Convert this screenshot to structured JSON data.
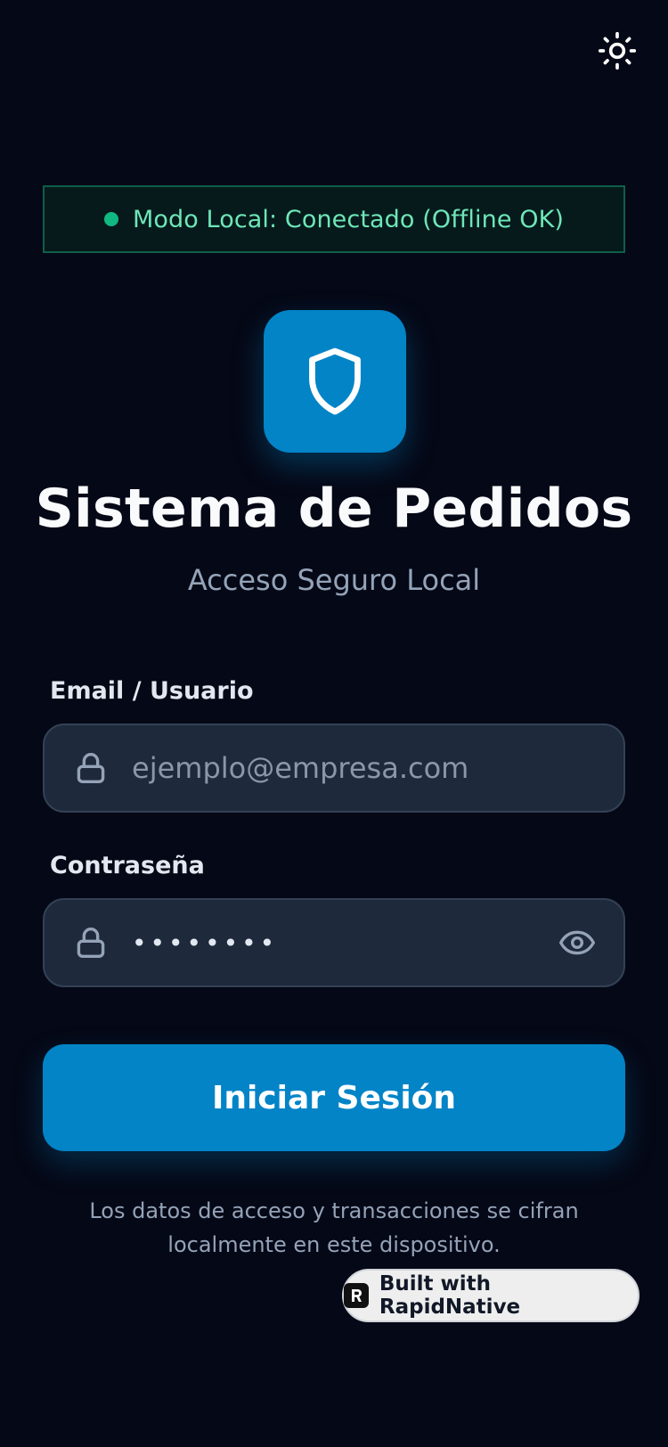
{
  "status": {
    "text": "Modo Local: Conectado (Offline OK)"
  },
  "header": {
    "title": "Sistema de Pedidos",
    "subtitle": "Acceso Seguro Local"
  },
  "form": {
    "email": {
      "label": "Email / Usuario",
      "placeholder": "ejemplo@empresa.com",
      "value": ""
    },
    "password": {
      "label": "Contraseña",
      "value": "••••••••"
    },
    "submit_label": "Iniciar Sesión"
  },
  "footer": {
    "note": "Los datos de acceso y transacciones se cifran localmente en este dispositivo."
  },
  "badge": {
    "label": "Built with RapidNative"
  },
  "icons": {
    "theme_toggle": "sun-icon",
    "logo": "shield-icon",
    "email_field": "lock-icon",
    "password_field": "lock-icon",
    "password_visibility": "eye-icon",
    "badge_logo": "rapidnative-logo-icon"
  },
  "colors": {
    "background": "#050816",
    "accent": "#0284c7",
    "status_green": "#10b981",
    "status_text": "#6ee7b7",
    "input_background": "#1e293b"
  }
}
